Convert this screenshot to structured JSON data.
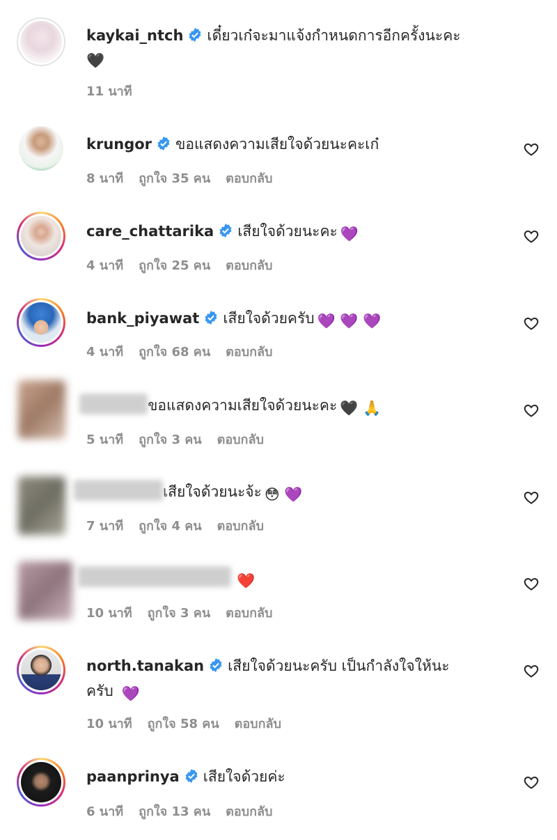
{
  "comments": [
    {
      "username": "kaykai_ntch",
      "verified": true,
      "text": "เดี๋ยวเก๋จะมาแจ้งกำหนดการอีกครั้งนะคะ",
      "emojis": "🖤",
      "time": "11 นาที",
      "likes": "",
      "reply": ""
    },
    {
      "username": "krungor",
      "verified": true,
      "text": "ขอแสดงความเสียใจด้วยนะคะเก๋",
      "time": "8 นาที",
      "likes": "ถูกใจ 35 คน",
      "reply": "ตอบกลับ"
    },
    {
      "username": "care_chattarika",
      "verified": true,
      "text": "เสียใจด้วยนะคะ",
      "emojis": "💜",
      "time": "4 นาที",
      "likes": "ถูกใจ 25 คน",
      "reply": "ตอบกลับ"
    },
    {
      "username": "bank_piyawat",
      "verified": true,
      "text": "เสียใจด้วยครับ",
      "emojis": "💜 💜 💜",
      "time": "4 นาที",
      "likes": "ถูกใจ 68 คน",
      "reply": "ตอบกลับ"
    },
    {
      "username": "",
      "verified": false,
      "text": "ขอแสดงความเสียใจด้วยนะคะ",
      "emojis": "🖤 🙏",
      "time": "5 นาที",
      "likes": "ถูกใจ 3 คน",
      "reply": "ตอบกลับ"
    },
    {
      "username": "",
      "verified": false,
      "text": "เสียใจด้วยนะจ้ะ",
      "emojis": "😳 💜",
      "time": "7 นาที",
      "likes": "ถูกใจ 4 คน",
      "reply": "ตอบกลับ"
    },
    {
      "username": "",
      "verified": false,
      "text": "",
      "emojis": "❤️",
      "time": "10 นาที",
      "likes": "ถูกใจ 3 คน",
      "reply": "ตอบกลับ"
    },
    {
      "username": "north.tanakan",
      "verified": true,
      "text": "เสียใจด้วยนะครับ เป็นกำลังใจให้นะ",
      "text2": "ครับ",
      "emojis": "💜",
      "time": "10 นาที",
      "likes": "ถูกใจ 58 คน",
      "reply": "ตอบกลับ"
    },
    {
      "username": "paanprinya",
      "verified": true,
      "text": "เสียใจด้วยค่ะ",
      "time": "6 นาที",
      "likes": "ถูกใจ 13 คน",
      "reply": "ตอบกลับ"
    }
  ],
  "colors": {
    "verified": "#3897f0",
    "meta": "#8e8e8e",
    "text": "#262626"
  },
  "icons": {
    "like": "heart-outline-icon",
    "verified": "verified-badge-icon"
  }
}
